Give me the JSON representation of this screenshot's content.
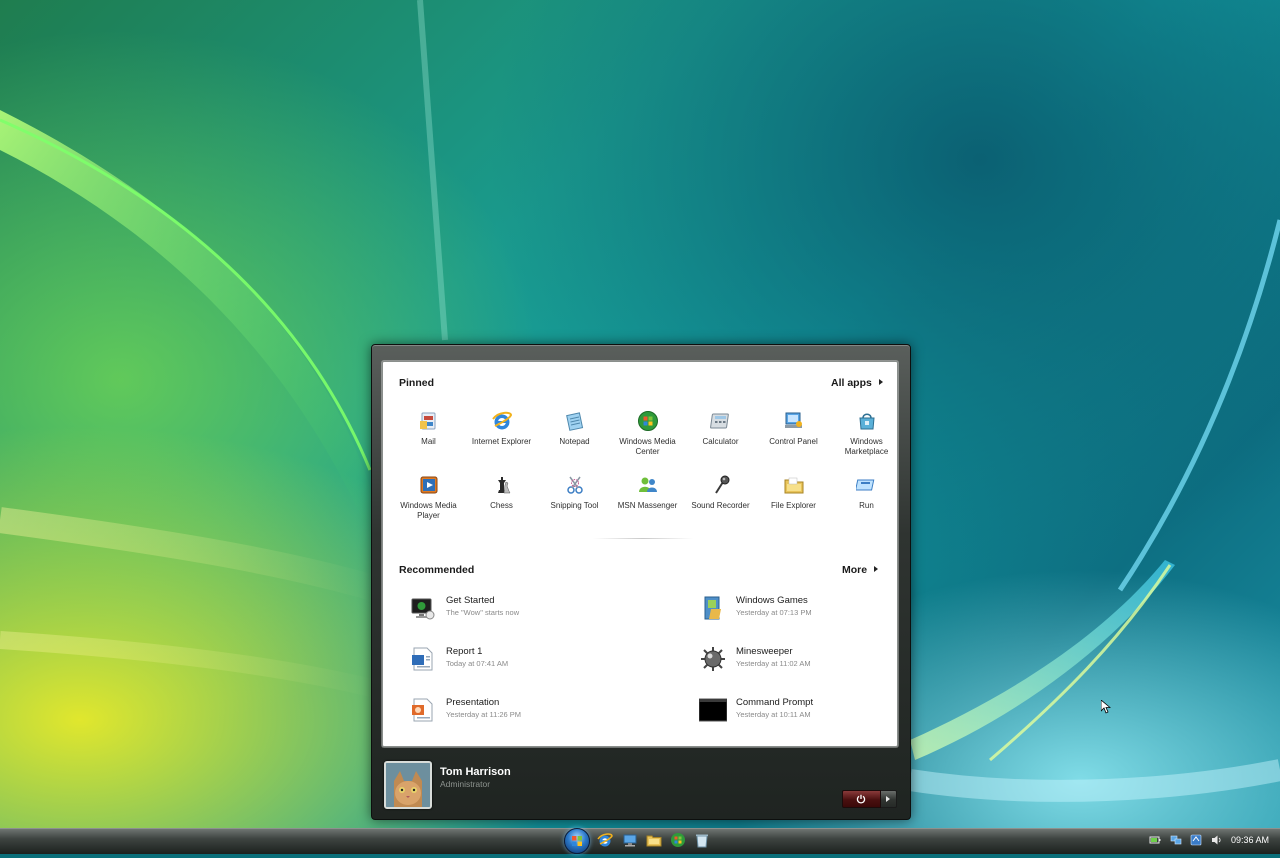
{
  "start_menu": {
    "pinned": {
      "title": "Pinned",
      "all_apps_label": "All apps",
      "apps": [
        {
          "label": "Mail",
          "icon": "mail-icon"
        },
        {
          "label": "Internet Explorer",
          "icon": "internet-explorer-icon"
        },
        {
          "label": "Notepad",
          "icon": "notepad-icon"
        },
        {
          "label": "Windows Media Center",
          "icon": "media-center-icon"
        },
        {
          "label": "Calculator",
          "icon": "calculator-icon"
        },
        {
          "label": "Control Panel",
          "icon": "control-panel-icon"
        },
        {
          "label": "Windows Marketplace",
          "icon": "marketplace-icon"
        },
        {
          "label": "Windows Media Player",
          "icon": "media-player-icon"
        },
        {
          "label": "Chess",
          "icon": "chess-icon"
        },
        {
          "label": "Snipping Tool",
          "icon": "snipping-tool-icon"
        },
        {
          "label": "MSN Massenger",
          "icon": "msn-messenger-icon"
        },
        {
          "label": "Sound Recorder",
          "icon": "microphone-icon"
        },
        {
          "label": "File Explorer",
          "icon": "folder-icon"
        },
        {
          "label": "Run",
          "icon": "run-icon"
        }
      ]
    },
    "recommended": {
      "title": "Recommended",
      "more_label": "More",
      "items": [
        {
          "name": "Get Started",
          "subtitle": "The \"Wow\" starts now",
          "icon": "get-started-icon"
        },
        {
          "name": "Windows Games",
          "subtitle": "Yesterday at 07:13 PM",
          "icon": "games-folder-icon"
        },
        {
          "name": "Report 1",
          "subtitle": "Today at 07:41 AM",
          "icon": "document-icon"
        },
        {
          "name": "Minesweeper",
          "subtitle": "Yesterday at 11:02 AM",
          "icon": "mine-icon"
        },
        {
          "name": "Presentation",
          "subtitle": "Yesterday at 11:26 PM",
          "icon": "presentation-icon"
        },
        {
          "name": "Command Prompt",
          "subtitle": "Yesterday at 10:11 AM",
          "icon": "command-prompt-icon"
        }
      ]
    },
    "user": {
      "name": "Tom Harrison",
      "role": "Administrator",
      "avatar_icon": "cat-avatar-icon"
    },
    "power": {
      "icon": "power-icon",
      "options_icon": "chevron-right-icon"
    }
  },
  "taskbar": {
    "start_icon": "windows-logo-icon",
    "quick_launch": [
      "internet-explorer-icon",
      "network-icon",
      "folder-icon",
      "media-center-icon",
      "recycle-bin-icon"
    ],
    "tray_icons": [
      "battery-icon",
      "network-icon",
      "sync-icon",
      "volume-icon"
    ],
    "clock": "09:36 AM"
  },
  "colors": {
    "menu_frame": "#2f3431",
    "menu_panel": "#ffffff",
    "power_button": "#6a1f1f",
    "taskbar": "#3d4340"
  }
}
